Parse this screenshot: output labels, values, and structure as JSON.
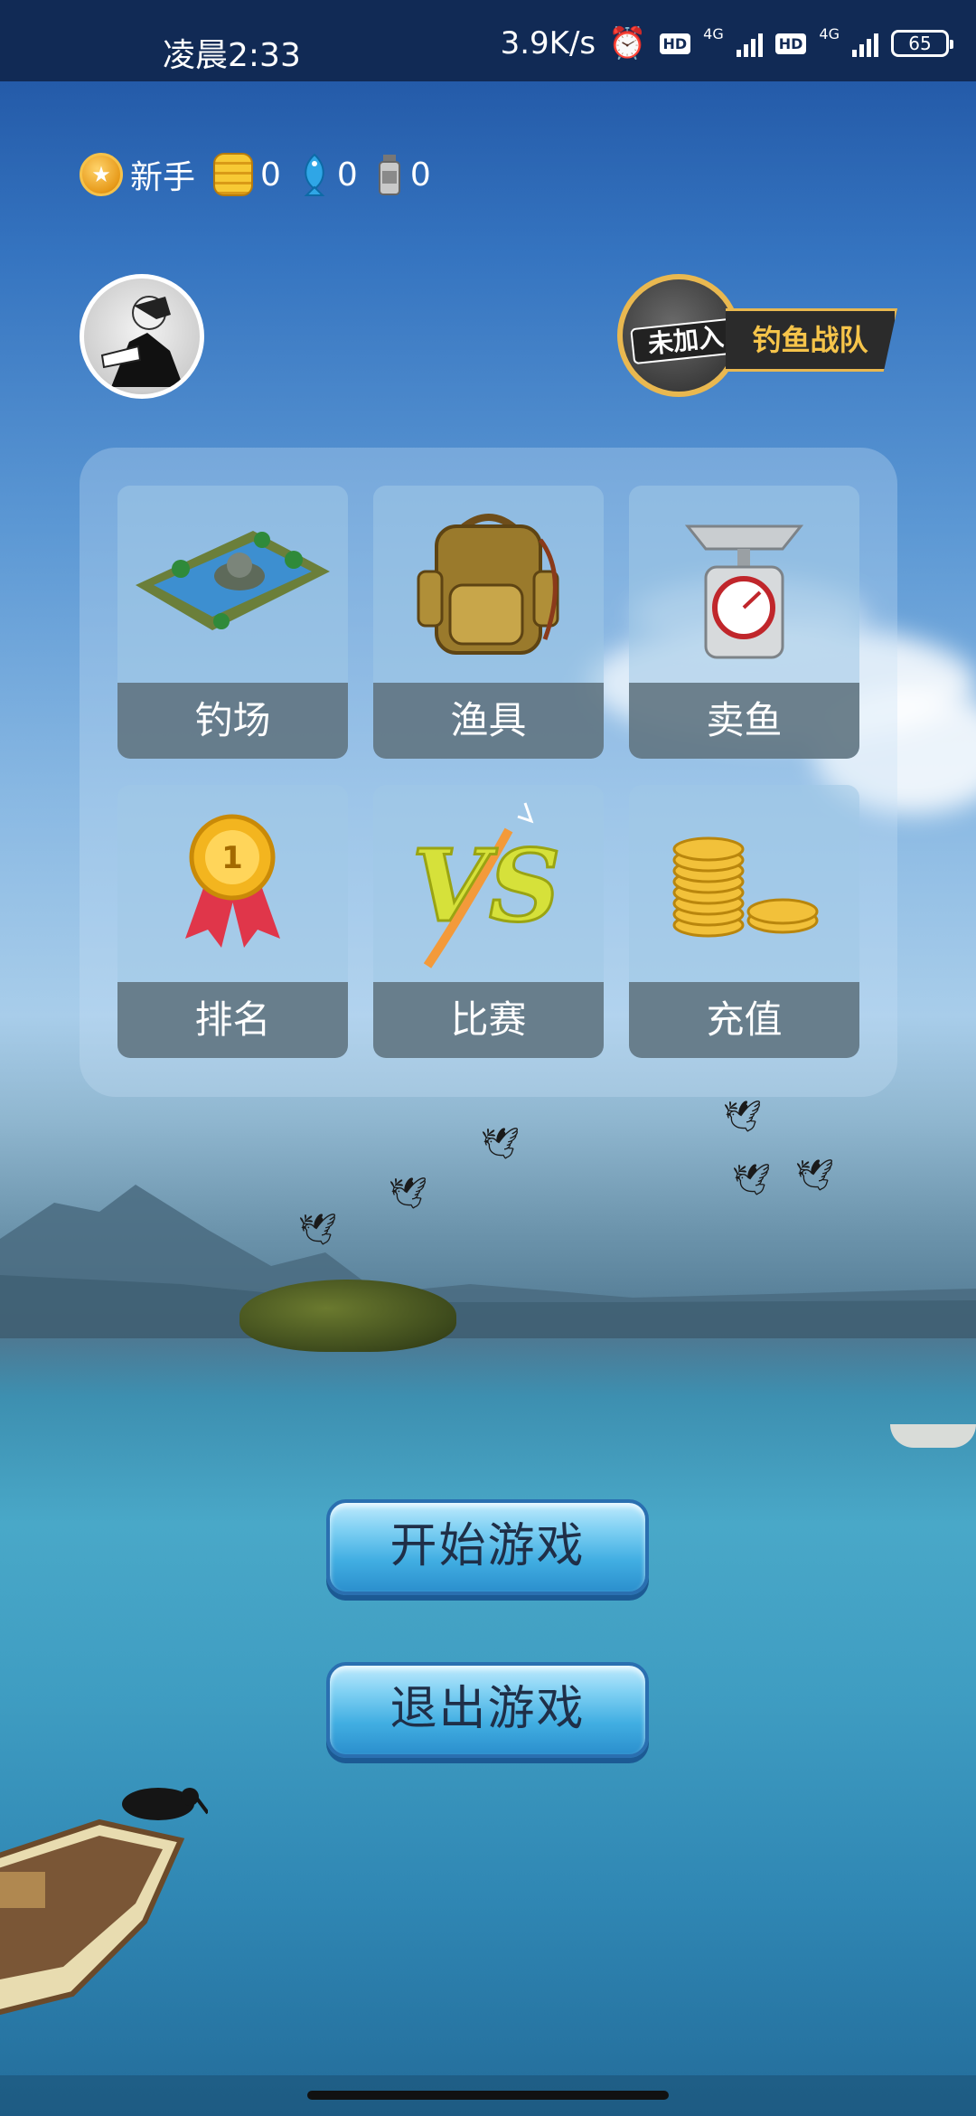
{
  "status_bar": {
    "time": "凌晨2:33",
    "speed": "3.9K/s",
    "hd1": "HD",
    "net1": "4G",
    "hd2": "HD",
    "net2": "4G",
    "battery": "65"
  },
  "stats": {
    "level_label": "新手",
    "coins": "0",
    "fish": "0",
    "bait": "0"
  },
  "team": {
    "status": "未加入",
    "name": "钓鱼战队"
  },
  "menu": {
    "items": [
      {
        "label": "钓场",
        "icon": "fishing-pond-icon"
      },
      {
        "label": "渔具",
        "icon": "backpack-icon"
      },
      {
        "label": "卖鱼",
        "icon": "scale-icon"
      },
      {
        "label": "排名",
        "icon": "medal-icon"
      },
      {
        "label": "比赛",
        "icon": "vs-icon"
      },
      {
        "label": "充值",
        "icon": "gold-coins-icon"
      }
    ]
  },
  "buttons": {
    "start": "开始游戏",
    "exit": "退出游戏"
  },
  "colors": {
    "status_bar_bg": "#112a55",
    "team_gold": "#e9b850",
    "button_blue": "#41aee2"
  }
}
